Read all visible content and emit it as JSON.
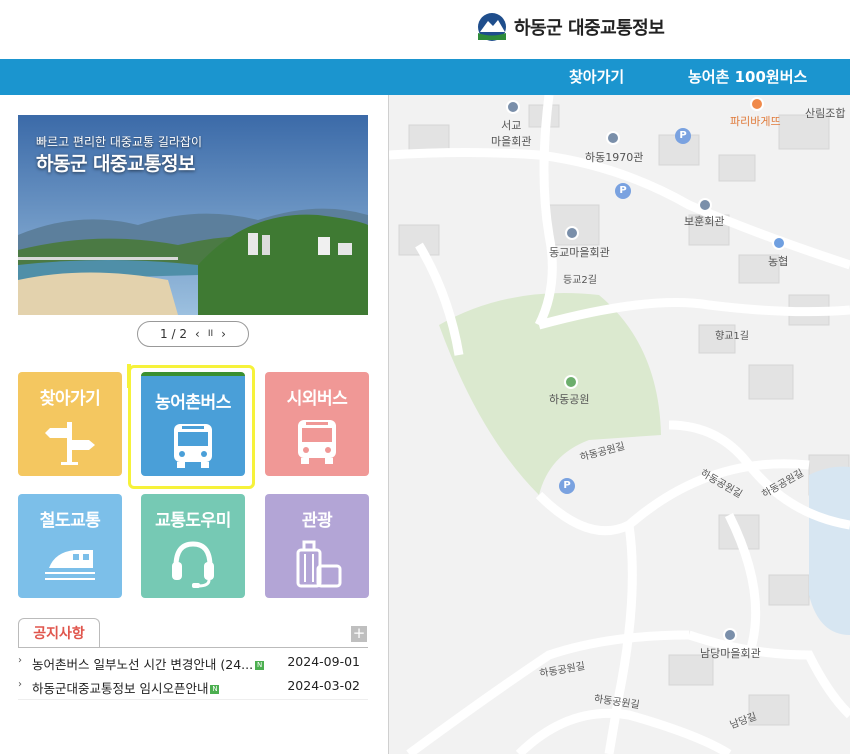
{
  "header": {
    "site_title": "하동군 대중교통정보"
  },
  "nav": {
    "find_route": "찾아가기",
    "bus_100": "농어촌 100원버스"
  },
  "banner": {
    "subtitle": "빠르고 편리한 대중교통 길라잡이",
    "title": "하동군 대중교통정보",
    "pager": "1 / 2",
    "prev": "‹",
    "pause": "II",
    "next": "›"
  },
  "tiles": [
    {
      "label": "찾아가기",
      "icon": "signpost-icon"
    },
    {
      "label": "농어촌버스",
      "icon": "bus-icon"
    },
    {
      "label": "시외버스",
      "icon": "bus-icon"
    },
    {
      "label": "철도교통",
      "icon": "train-icon"
    },
    {
      "label": "교통도우미",
      "icon": "headset-icon"
    },
    {
      "label": "관광",
      "icon": "luggage-icon"
    }
  ],
  "notice": {
    "tab": "공지사항",
    "more": "+",
    "new_badge": "N",
    "items": [
      {
        "title": "농어촌버스 일부노선 시간 변경안내 (24...",
        "date": "2024-09-01"
      },
      {
        "title": "하동군대중교통정보 임시오픈안내",
        "date": "2024-03-02"
      }
    ]
  },
  "map": {
    "labels": [
      "서교\n마을회관",
      "하동1970관",
      "파리바게뜨",
      "산림조합",
      "보훈회관",
      "동교마을회관",
      "농협",
      "등교2길",
      "향교1길",
      "하동공원",
      "하동공원길",
      "하동공원길",
      "하동공원길",
      "하동공원길",
      "남당마을회관",
      "하동공원길",
      "남당길"
    ],
    "parking": "P"
  },
  "colors": {
    "nav_bg": "#1b95cf",
    "highlight": "#f6f23a",
    "notice_accent": "#e0564d"
  }
}
